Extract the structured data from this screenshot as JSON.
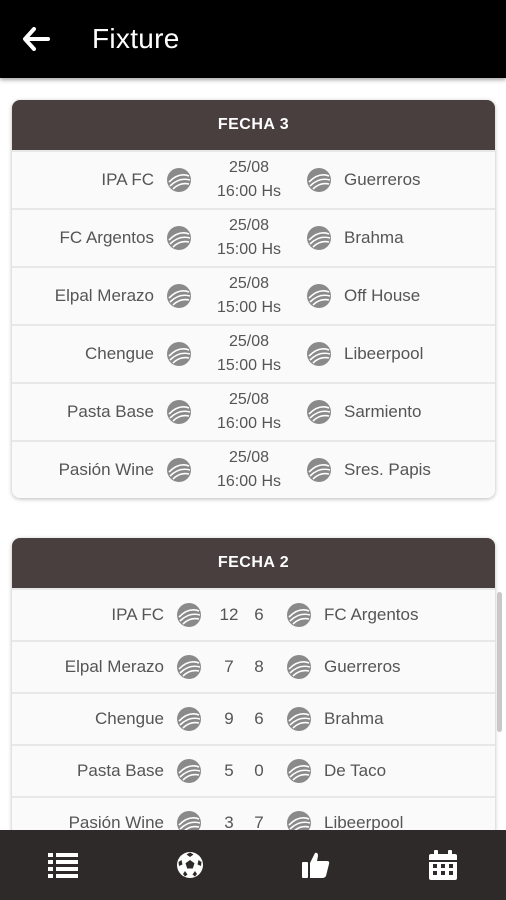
{
  "header": {
    "title": "Fixture",
    "back_icon": "arrow-left-icon"
  },
  "fecha3": {
    "title": "FECHA 3",
    "matches": [
      {
        "home": "IPA FC",
        "date": "25/08",
        "time": "16:00 Hs",
        "away": "Guerreros"
      },
      {
        "home": "FC Argentos",
        "date": "25/08",
        "time": "15:00 Hs",
        "away": "Brahma"
      },
      {
        "home": "Elpal Merazo",
        "date": "25/08",
        "time": "15:00 Hs",
        "away": "Off House"
      },
      {
        "home": "Chengue",
        "date": "25/08",
        "time": "15:00 Hs",
        "away": "Libeerpool"
      },
      {
        "home": "Pasta Base",
        "date": "25/08",
        "time": "16:00 Hs",
        "away": "Sarmiento"
      },
      {
        "home": "Pasión Wine",
        "date": "25/08",
        "time": "16:00 Hs",
        "away": "Sres. Papis"
      }
    ]
  },
  "fecha2": {
    "title": "FECHA 2",
    "results": [
      {
        "home": "IPA FC",
        "home_score": "12",
        "away_score": "6",
        "away": "FC Argentos"
      },
      {
        "home": "Elpal Merazo",
        "home_score": "7",
        "away_score": "8",
        "away": "Guerreros"
      },
      {
        "home": "Chengue",
        "home_score": "9",
        "away_score": "6",
        "away": "Brahma"
      },
      {
        "home": "Pasta Base",
        "home_score": "5",
        "away_score": "0",
        "away": "De Taco"
      },
      {
        "home": "Pasión Wine",
        "home_score": "3",
        "away_score": "7",
        "away": "Libeerpool"
      }
    ]
  },
  "bottom_nav": [
    {
      "icon": "list-icon"
    },
    {
      "icon": "soccer-ball-icon"
    },
    {
      "icon": "thumbs-up-icon"
    },
    {
      "icon": "calendar-icon"
    }
  ],
  "colors": {
    "topbar": "#000000",
    "card_header": "#483f3e",
    "bottom_bar": "#2e2a29"
  }
}
